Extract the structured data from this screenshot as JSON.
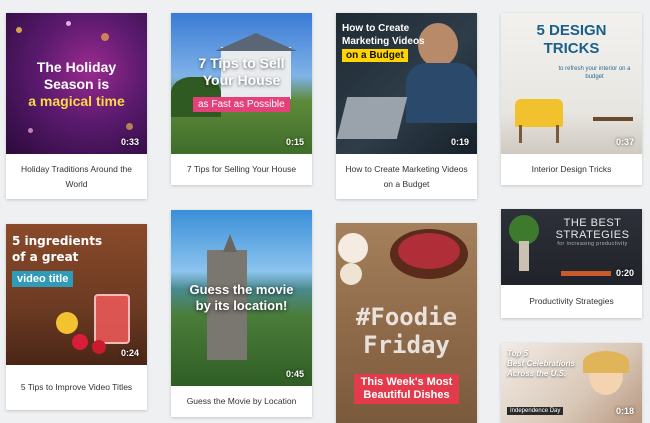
{
  "videos": [
    {
      "title_lines": [
        "The Holiday",
        "Season is"
      ],
      "highlight": "a magical time",
      "duration": "0:33",
      "caption": "Holiday Traditions Around the World"
    },
    {
      "title_lines": [
        "7 Tips to Sell",
        "Your House"
      ],
      "highlight": "as Fast as Possible",
      "duration": "0:15",
      "caption": "7 Tips for Selling Your House"
    },
    {
      "title_lines": [
        "How to Create",
        "Marketing Videos"
      ],
      "highlight": "on a Budget",
      "duration": "0:19",
      "caption": "How to Create Marketing Videos on a Budget"
    },
    {
      "title_lines": [
        "5 DESIGN",
        "TRICKS"
      ],
      "highlight": "to refresh your interior on a budget",
      "duration": "0:37",
      "caption": "Interior Design Tricks"
    },
    {
      "title_lines": [
        "5 ingredients",
        "of a great"
      ],
      "highlight": "video title",
      "duration": "0:24",
      "caption": "5 Tips to Improve Video Titles"
    },
    {
      "title_lines": [
        "Guess the movie",
        "by its location!"
      ],
      "highlight": "",
      "duration": "0:45",
      "caption": "Guess the Movie by Location"
    },
    {
      "title_lines": [
        "#Foodie",
        "Friday"
      ],
      "highlight": "This Week's Most Beautiful Dishes",
      "duration": "",
      "caption": ""
    },
    {
      "title_lines": [
        "THE BEST",
        "STRATEGIES"
      ],
      "highlight": "for increasing productivity",
      "duration": "0:20",
      "caption": "Productivity Strategies"
    },
    {
      "title_lines": [
        "Top 5",
        "Best Celebrations",
        "Across the U.S."
      ],
      "highlight": "Independence Day",
      "duration": "0:18",
      "caption": ""
    }
  ]
}
